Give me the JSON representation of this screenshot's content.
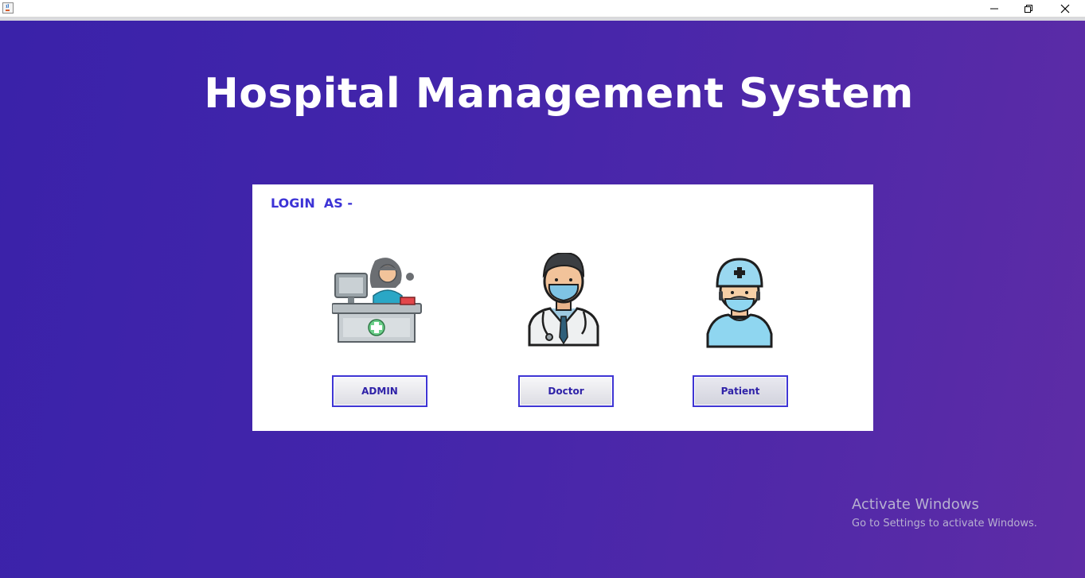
{
  "window": {
    "controls": [
      "minimize-icon",
      "restore-icon",
      "close-icon"
    ],
    "app_icon": "java-cup-icon"
  },
  "header": {
    "title": "Hospital Management System"
  },
  "login": {
    "heading": "LOGIN  AS -",
    "roles": [
      {
        "label": "ADMIN",
        "icon": "receptionist-desk-icon"
      },
      {
        "label": "Doctor",
        "icon": "doctor-icon"
      },
      {
        "label": "Patient",
        "icon": "patient-icon"
      }
    ]
  },
  "watermark": {
    "title": "Activate Windows",
    "subtitle": "Go to Settings to activate Windows."
  },
  "colors": {
    "background_start": "#3a22a9",
    "background_end": "#5e2ca6",
    "accent": "#3f35d4",
    "heading": "#3c33d6",
    "panel": "#ffffff"
  }
}
